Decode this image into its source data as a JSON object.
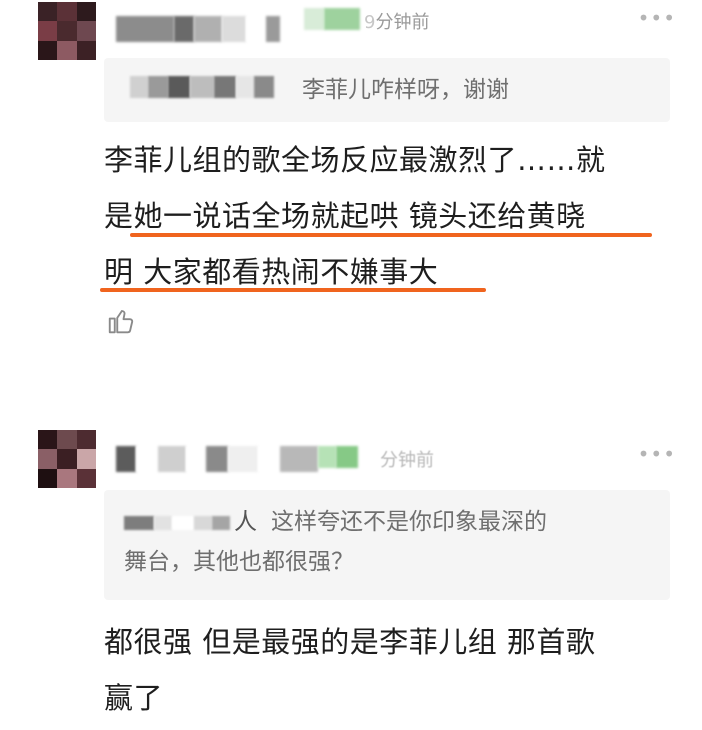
{
  "comments": [
    {
      "time": "分钟前",
      "time_prefix": "9",
      "reply_to_text": "李菲儿咋样呀，谢谢",
      "body_lines": [
        "李菲儿组的歌全场反应最激烈了……就",
        "是她一说话全场就起哄 镜头还给黄晓",
        "明 大家都看热闹不嫌事大"
      ],
      "more_icon": "more-dots-icon",
      "like_icon": "thumbs-up-icon"
    },
    {
      "time": "分钟前",
      "reply_to_lines": [
        "这样夸还不是你印象最深的",
        "舞台，其他也都很强？"
      ],
      "reply_prefix": "人",
      "body_lines": [
        "都很强 但是最强的是李菲儿组 那首歌",
        "赢了"
      ],
      "more_icon": "more-dots-icon"
    }
  ],
  "colors": {
    "highlight_underline": "#f0641e",
    "quote_bg": "#f5f5f5",
    "meta_text": "#9a9a9a"
  }
}
